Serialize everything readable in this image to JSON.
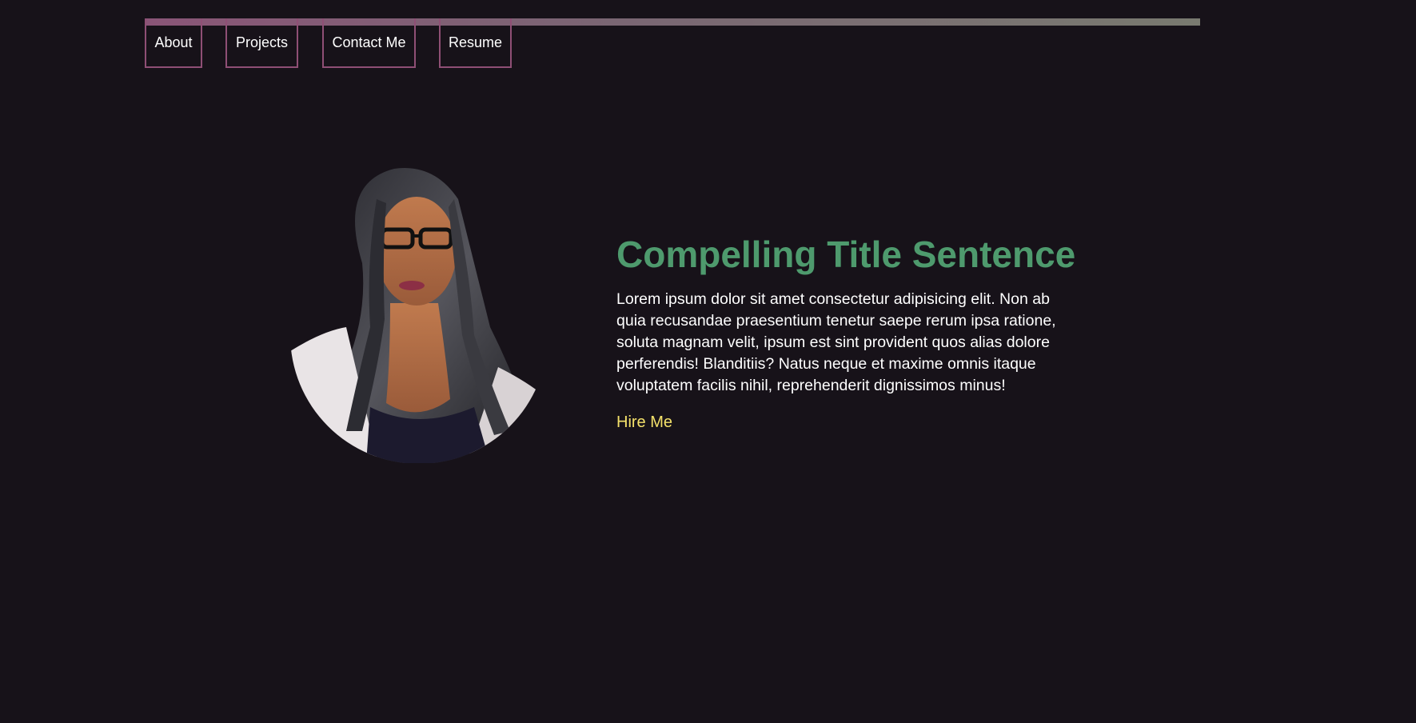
{
  "nav": {
    "items": [
      {
        "label": "About"
      },
      {
        "label": "Projects"
      },
      {
        "label": "Contact Me"
      },
      {
        "label": "Resume"
      }
    ]
  },
  "hero": {
    "title": "Compelling Title Sentence",
    "body": "Lorem ipsum dolor sit amet consectetur adipisicing elit. Non ab quia recusandae praesentium tenetur saepe rerum ipsa ratione, soluta magnam velit, ipsum est sint provident quos alias dolore perferendis! Blanditiis? Natus neque et maxime omnis itaque voluptatem facilis nihil, reprehenderit dignissimos minus!",
    "cta_label": "Hire Me"
  },
  "colors": {
    "background": "#171219",
    "nav_border": "#8f4f75",
    "title": "#4e9a6d",
    "body_text": "#ffffff",
    "cta": "#f4e16a",
    "gradient_start": "#8a5577",
    "gradient_end": "#797a70"
  }
}
